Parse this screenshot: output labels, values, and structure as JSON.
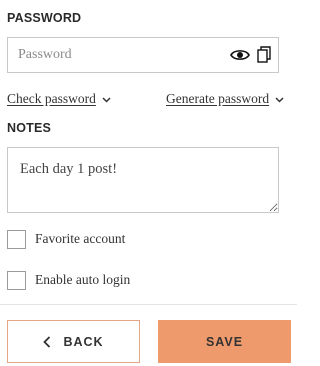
{
  "password": {
    "title": "PASSWORD",
    "placeholder": "Password",
    "value": "",
    "icons": {
      "show": "eye-icon",
      "copy": "copy-icon"
    },
    "check_label": "Check password",
    "generate_label": "Generate password"
  },
  "notes": {
    "title": "NOTES",
    "value": "Each day 1 post!"
  },
  "options": {
    "favorite_label": "Favorite account",
    "favorite_checked": false,
    "auto_login_label": "Enable auto login",
    "auto_login_checked": false
  },
  "actions": {
    "back_label": "BACK",
    "save_label": "SAVE"
  },
  "colors": {
    "accent": "#ee9a6d",
    "accent_border": "#e5a686",
    "field_border": "#c9c9c9"
  }
}
